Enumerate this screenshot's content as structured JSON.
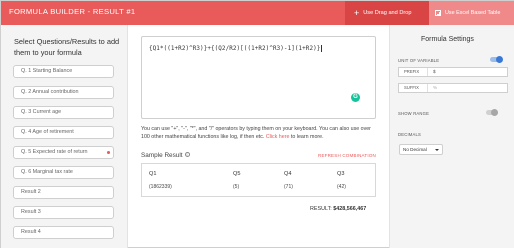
{
  "header": {
    "title": "FORMULA BUILDER - RESULT #1",
    "drag_drop_label": "Use Drag and Drop",
    "excel_label": "Use Excel Based Table"
  },
  "sidebar": {
    "intro": "Select Questions/Results to add them to your formula",
    "items": [
      {
        "label": "Q. 1 Starting Balance",
        "highlight": false
      },
      {
        "label": "Q. 2 Annual contribution",
        "highlight": false
      },
      {
        "label": "Q. 3 Current age",
        "highlight": false
      },
      {
        "label": "Q. 4 Age of retirement",
        "highlight": false
      },
      {
        "label": "Q. 5 Expected rate of return",
        "highlight": true
      },
      {
        "label": "Q. 6 Marginal tax rate",
        "highlight": false
      },
      {
        "label": "Result 2",
        "highlight": false
      },
      {
        "label": "Result 3",
        "highlight": false
      },
      {
        "label": "Result 4",
        "highlight": false
      }
    ]
  },
  "editor": {
    "formula": "{Q1*((1+R2)^R3)}+{(Q2/R2)[((1+R2)^R3)-1](1+R2)}",
    "hint_prefix": "You can use \"+\", \"-\", \"*\", and \"/\" operators by typing them on your keyboard. You can also use over 100 other mathematical functions like log, if then etc.",
    "hint_link": "Click here",
    "hint_suffix": "to learn more."
  },
  "sample": {
    "label": "Sample Result",
    "refresh": "REFRESH COMBINATION",
    "headers": [
      "Q1",
      "Q5",
      "Q4",
      "Q3"
    ],
    "values": [
      "(1862339)",
      "(5)",
      "(71)",
      "(42)"
    ],
    "result_label": "RESULT:",
    "result_value": "$428,566,467"
  },
  "settings": {
    "title": "Formula Settings",
    "unit_label": "UNIT OF VARIABLE",
    "unit_on": true,
    "prefix_label": "PREFIX",
    "prefix_value": "$",
    "suffix_label": "SUFFIX",
    "suffix_placeholder": "%",
    "show_range_label": "SHOW RANGE",
    "show_range_on": false,
    "decimals_label": "DECIMALS",
    "decimals_value": "No Decimal"
  },
  "colors": {
    "accent": "#e95a5a",
    "toggle_on": "#3a78d8",
    "grammar_icon": "#15c39a"
  }
}
